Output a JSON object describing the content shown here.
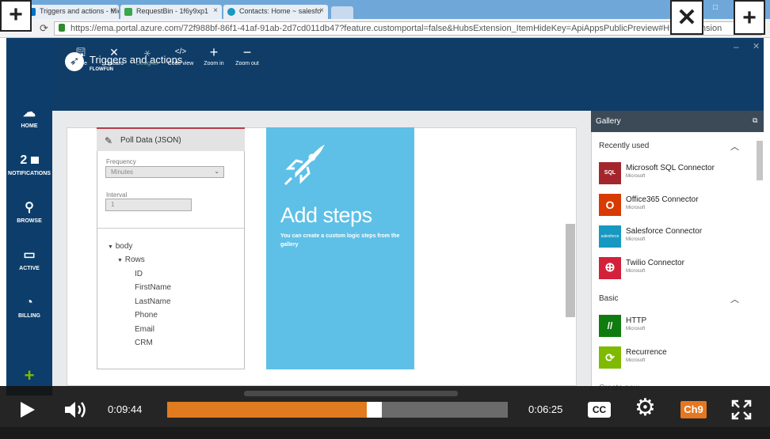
{
  "browser": {
    "tabs": [
      {
        "title": "Triggers and actions - Mic",
        "color": "#0072c6"
      },
      {
        "title": "RequestBin - 1f6y9xp1",
        "color": "#3aa64d"
      },
      {
        "title": "Contacts: Home ~ salesfo",
        "color": "#1798c1"
      }
    ],
    "url": "https://ema.portal.azure.com/72f988bf-86f1-41af-91ab-2d7cd011db47?feature.customportal=false&HubsExtension_ItemHideKey=ApiAppsPublicPreview#HubsExtension"
  },
  "overlays": {
    "plus": "+",
    "close": "✕"
  },
  "leftnav": [
    {
      "label": "HOME",
      "icon": "cloud-icon",
      "glyph": "☁"
    },
    {
      "label": "NOTIFICATIONS",
      "icon": "notification-icon",
      "count": "2"
    },
    {
      "label": "BROWSE",
      "icon": "browse-icon",
      "glyph": "⚲"
    },
    {
      "label": "ACTIVE",
      "icon": "active-icon",
      "glyph": "▭"
    },
    {
      "label": "BILLING",
      "icon": "billing-icon",
      "glyph": "◔"
    },
    {
      "label": "NEW",
      "icon": "plus-icon",
      "glyph": "+"
    }
  ],
  "blade": {
    "title": "Triggers and actions",
    "subtitle": "FLOWFUN",
    "toolbar": [
      {
        "label": "Save",
        "glyph": "🖫"
      },
      {
        "label": "Discard",
        "glyph": "✕"
      },
      {
        "label": "Designer",
        "glyph": "⚹"
      },
      {
        "label": "Code view",
        "glyph": "</>"
      },
      {
        "label": "Zoom in",
        "glyph": "+"
      },
      {
        "label": "Zoom out",
        "glyph": "−"
      }
    ]
  },
  "poll": {
    "title": "Poll Data (JSON)",
    "frequency_label": "Frequency",
    "frequency_value": "Minutes",
    "interval_label": "Interval",
    "interval_value": "1",
    "tree": {
      "root": "body",
      "child": "Rows",
      "fields": [
        "ID",
        "FirstName",
        "LastName",
        "Phone",
        "Email",
        "CRM"
      ]
    }
  },
  "addsteps": {
    "title": "Add steps",
    "description": "You can create a custom logic steps from the gallery"
  },
  "gallery": {
    "title": "Gallery",
    "recently_used": "Recently used",
    "basic": "Basic",
    "create_new": "Create new",
    "recent_items": [
      {
        "name": "Microsoft SQL Connector",
        "sub": "Microsoft",
        "color": "#a4262c",
        "icon_text": "SQL"
      },
      {
        "name": "Office365 Connector",
        "sub": "Microsoft",
        "color": "#d83b01",
        "icon_text": "O"
      },
      {
        "name": "Salesforce Connector",
        "sub": "Microsoft",
        "color": "#1798c1",
        "icon_text": "salesforce"
      },
      {
        "name": "Twilio Connector",
        "sub": "Microsoft",
        "color": "#d1223a",
        "icon_text": "⊕"
      }
    ],
    "basic_items": [
      {
        "name": "HTTP",
        "sub": "Microsoft",
        "color": "#107c10",
        "icon_text": "//"
      },
      {
        "name": "Recurrence",
        "sub": "Microsoft",
        "color": "#7fba00",
        "icon_text": "⟳"
      }
    ]
  },
  "player": {
    "elapsed": "0:09:44",
    "remaining": "0:06:25",
    "progress": 0.585,
    "cc": "CC",
    "brand": "Ch9"
  }
}
